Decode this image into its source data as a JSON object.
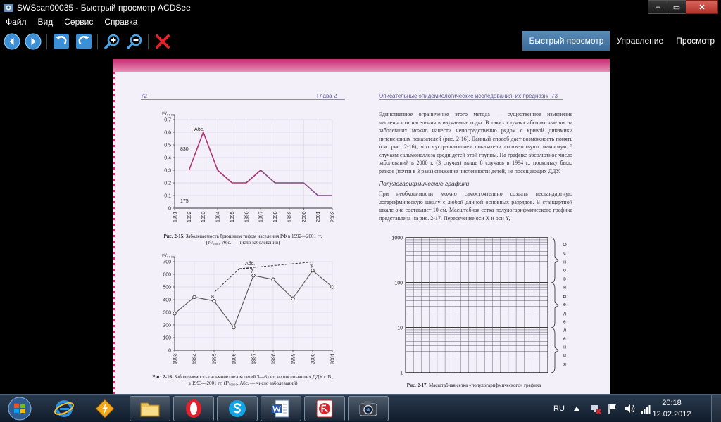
{
  "window": {
    "title": "SWScan00035 - Быстрый просмотр ACDSee",
    "controls": {
      "minimize": "–",
      "maximize": "▭",
      "close": "✕"
    }
  },
  "menu": {
    "items": [
      "Файл",
      "Вид",
      "Сервис",
      "Справка"
    ]
  },
  "toolbar": {
    "icons": [
      "back-arrow-icon",
      "forward-arrow-icon",
      "rotate-left-icon",
      "rotate-right-icon",
      "zoom-in-icon",
      "zoom-out-icon",
      "delete-icon"
    ],
    "modes": [
      "Быстрый просмотр",
      "Управление",
      "Просмотр"
    ],
    "active_mode": "Быстрый просмотр"
  },
  "scan": {
    "left_header": {
      "page": "72",
      "chapter": "Глава 2"
    },
    "right_header": {
      "title": "Описательные эпидемиологические исследования, их предназначение...",
      "page": "73"
    },
    "paragraph1": "Единственное ограничение этого метода — существенное изменение численности населения в изучаемые годы. В таких случаях абсолютные числа заболевших можно нанести непосредственно рядом с кривой динамики интенсивных показателей (рис. 2-16). Данный способ дает возможность понять (см. рис. 2-16), что «устрашающие» показатели соответствуют максимум 8 случаям сальмонеллеза среди детей этой группы. На графике абсолютное число заболеваний в 2000 г. (3 случая) выше 8 случаев в 1994 г., поскольку было резкое (почти в 3 раза) снижение численности детей, не посещающих ДДУ.",
    "subheading": "Полулогарифмические графики",
    "paragraph2": "При необходимости можно самостоятельно создать нестандартную логарифмическую шкалу с любой длиной основных разрядов. В стандартной шкале она составляет 10 см. Масштабная сетка полулогарифмического графика представлена на рис. 2-17. Пересечение оси X и оси Y,",
    "fig15_caption_title": "Рис. 2-15.",
    "fig15_caption": " Заболеваемость брюшным тифом населения РФ в 1992—2001 гг.",
    "fig15_caption_line2": "(I⁰/₀₀₀₀, Абс. — число заболеваний)",
    "fig16_caption_title": "Рис. 2-16.",
    "fig16_caption": " Заболеваемость сальмонеллезом детей 3—6 лет, не посещающих ДДУ г. В.,",
    "fig16_caption_line2": "в 1993—2001 гг. (I⁰/₀₀₀₀, Абс. — число заболеваний)",
    "fig17_caption_title": "Рис. 2-17.",
    "fig17_caption": " Масштабная сетка «полулогарифмического» графика",
    "fig17_side_label": "Основные деления"
  },
  "chart_data": [
    {
      "type": "line",
      "ylabel": "I⁰/₀₀₀₀",
      "legend": "~ Абс.",
      "categories": [
        "1991",
        "1992",
        "1993",
        "1994",
        "1995",
        "1996",
        "1997",
        "1998",
        "1999",
        "2000",
        "2001",
        "2002"
      ],
      "y_ticks": [
        "0",
        "0,1",
        "0,2",
        "0,3",
        "0,4",
        "0,5",
        "0,6",
        "0,7"
      ],
      "ylim": [
        0,
        0.7
      ],
      "series": [
        {
          "values": [
            null,
            0.3,
            0.6,
            0.3,
            0.2,
            0.2,
            0.3,
            0.2,
            0.2,
            0.2,
            0.1,
            0.1
          ]
        },
        {
          "values": [
            null,
            null,
            null,
            null,
            null,
            null,
            0.3,
            0.2,
            0.2,
            0.2,
            0.1,
            0.1
          ]
        }
      ],
      "annotations": [
        "830",
        "175"
      ]
    },
    {
      "type": "line",
      "ylabel": "I⁰/₀₀₀₀",
      "legend": "Абс.",
      "categories": [
        "1993",
        "1994",
        "1995",
        "1996",
        "1997",
        "1998",
        "1999",
        "2000",
        "2001"
      ],
      "y_ticks": [
        "0",
        "100",
        "200",
        "300",
        "400",
        "500",
        "600",
        "700"
      ],
      "ylim": [
        0,
        700
      ],
      "series": [
        {
          "values": [
            290,
            420,
            390,
            180,
            590,
            560,
            410,
            630,
            500
          ]
        }
      ],
      "point_labels": [
        "",
        "",
        "8",
        "",
        "7",
        "",
        "",
        "3",
        ""
      ]
    },
    {
      "type": "line",
      "y_ticks": [
        "1",
        "10",
        "100",
        "1000"
      ],
      "ylim": [
        1,
        1000
      ],
      "log_scale": true,
      "grid": true
    }
  ],
  "taskbar": {
    "apps": [
      "windows-explorer-icon",
      "internet-explorer-icon",
      "winamp-icon",
      "folder-icon",
      "opera-icon",
      "skype-icon",
      "word-icon",
      "foxit-reader-icon",
      "acdsee-icon"
    ],
    "language": "RU",
    "time": "20:18",
    "date": "12.02.2012"
  }
}
